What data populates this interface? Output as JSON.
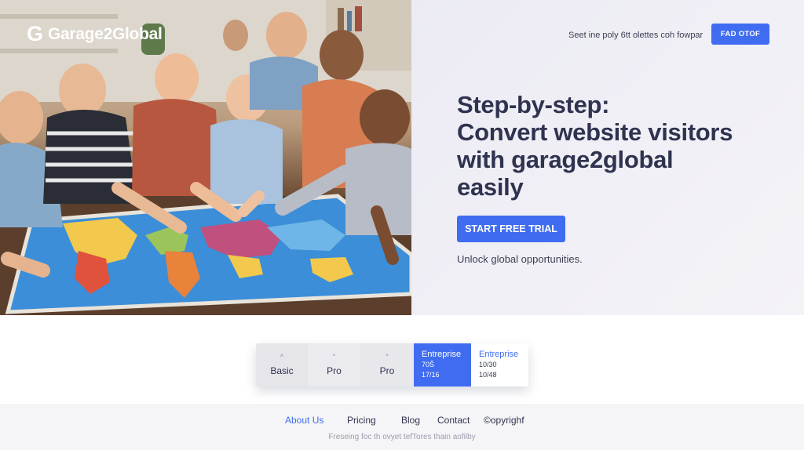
{
  "brand": {
    "mark": "G",
    "name": "Garage2Global"
  },
  "header": {
    "note": "Seet ine poly 6tt olettes coh fowpar",
    "button_label": "FAD OTOF"
  },
  "hero": {
    "headline": [
      "Step-by-step:",
      "Convert website visitors",
      "with garage2global",
      "easily"
    ],
    "cta_label": "START FREE TRIAL",
    "tagline": "Unlock global opportunities."
  },
  "pricing": {
    "plans": [
      {
        "name": "Basic",
        "mark": "^"
      },
      {
        "name": "Pro",
        "mark": "°"
      },
      {
        "name": "Pro",
        "mark": "°"
      },
      {
        "name": "Entreprise",
        "line1": "70Š",
        "line2": "17/16"
      },
      {
        "name": "Entreprise",
        "line1": "10/30",
        "line2": "10/48"
      }
    ]
  },
  "footer": {
    "links": [
      "About Us",
      "Pricing",
      "Blog",
      "Contact",
      "©opyrighf"
    ],
    "copyright": "Freseing foc th ovyet tefTores thain aofilby"
  },
  "colors": {
    "accent": "#3f6cf0",
    "text": "#2f3350"
  }
}
